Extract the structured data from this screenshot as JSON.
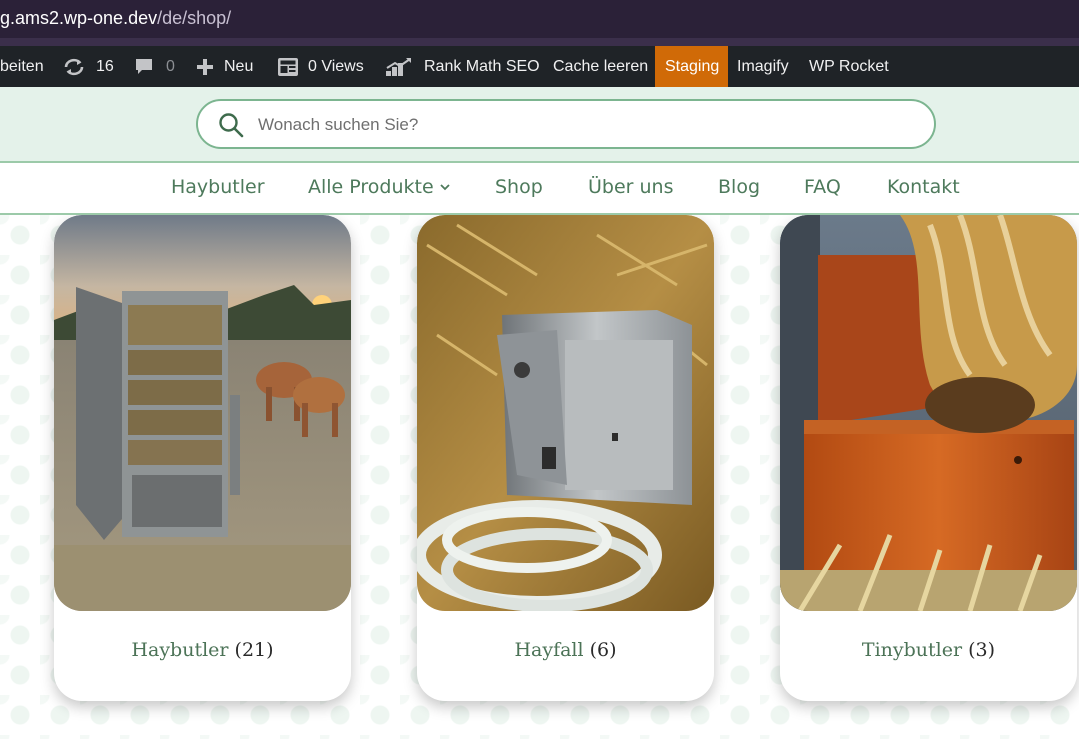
{
  "browser": {
    "url_host": "g.ams2.wp-one.dev",
    "url_path": "/de/shop/"
  },
  "adminbar": {
    "edit_label": "beiten",
    "updates_count": "16",
    "comments_count": "0",
    "new_label": "Neu",
    "views_label": "0 Views",
    "rankmath_label": "Rank Math SEO",
    "cache_label": "Cache leeren",
    "staging_label": "Staging",
    "imagify_label": "Imagify",
    "rocket_label": "WP Rocket",
    "colors": {
      "bar": "#1f2327",
      "staging": "#d06a07"
    }
  },
  "search": {
    "placeholder": "Wonach suchen Sie?",
    "value": ""
  },
  "nav": {
    "items": [
      {
        "label": "Haybutler"
      },
      {
        "label": "Alle Produkte",
        "icon": "chevron-down-icon"
      },
      {
        "label": "Shop"
      },
      {
        "label": "Über uns"
      },
      {
        "label": "Blog"
      },
      {
        "label": "FAQ"
      },
      {
        "label": "Kontakt"
      }
    ],
    "color": "#4e7a5c"
  },
  "categories": [
    {
      "name": "Haybutler",
      "count": "(21)"
    },
    {
      "name": "Hayfall",
      "count": "(6)"
    },
    {
      "name": "Tinybutler",
      "count": "(3)"
    }
  ]
}
